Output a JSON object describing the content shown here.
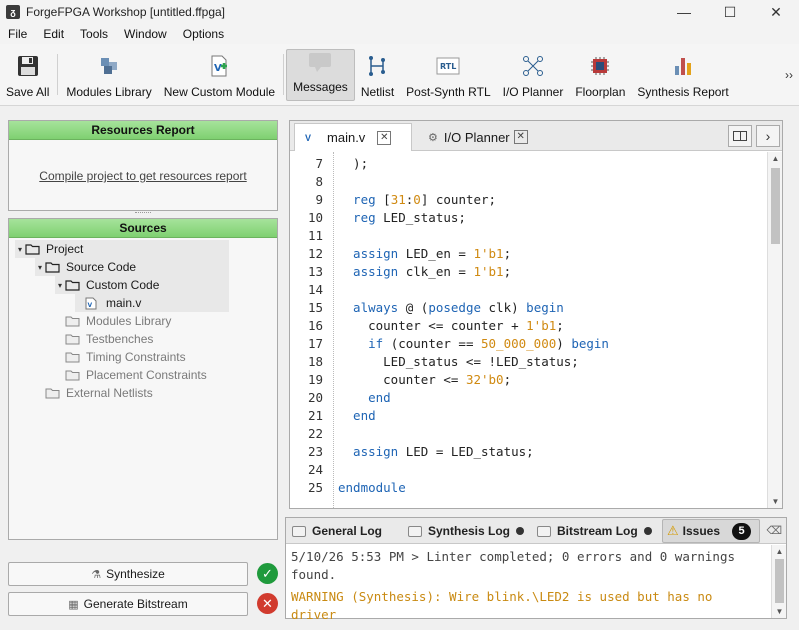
{
  "window": {
    "title": "ForgeFPGA Workshop [untitled.ffpga]",
    "app_icon": "ᵹ",
    "controls": [
      "—",
      "☐",
      "✕"
    ]
  },
  "menu": [
    "File",
    "Edit",
    "Tools",
    "Window",
    "Options"
  ],
  "toolbar": {
    "items": [
      {
        "label": "Save All",
        "icon": "floppy-icon"
      },
      {
        "label": "Modules Library",
        "icon": "cubes-icon"
      },
      {
        "label": "New Custom Module",
        "icon": "new-module-icon"
      },
      {
        "label": "Messages",
        "icon": "speech-bubble-icon",
        "active": true
      },
      {
        "label": "Netlist",
        "icon": "netlist-icon"
      },
      {
        "label": "Post-Synth RTL",
        "icon": "rtl-icon"
      },
      {
        "label": "I/O Planner",
        "icon": "io-planner-icon"
      },
      {
        "label": "Floorplan",
        "icon": "chip-icon"
      },
      {
        "label": "Synthesis Report",
        "icon": "bar-chart-icon"
      }
    ],
    "more": "››"
  },
  "resources": {
    "title": "Resources Report",
    "link": "Compile project to get resources report"
  },
  "sources": {
    "title": "Sources",
    "tree": [
      {
        "label": "Project",
        "level": 0,
        "caret": "▾",
        "type": "folder",
        "muted": false
      },
      {
        "label": "Source Code",
        "level": 1,
        "caret": "▾",
        "type": "folder",
        "muted": false
      },
      {
        "label": "Custom Code",
        "level": 2,
        "caret": "▾",
        "type": "folder",
        "muted": false
      },
      {
        "label": "main.v",
        "level": 3,
        "caret": "",
        "type": "file",
        "muted": false
      },
      {
        "label": "Modules Library",
        "level": 2,
        "caret": "",
        "type": "folder",
        "muted": true
      },
      {
        "label": "Testbenches",
        "level": 2,
        "caret": "",
        "type": "folder",
        "muted": true
      },
      {
        "label": "Timing Constraints",
        "level": 2,
        "caret": "",
        "type": "folder",
        "muted": true
      },
      {
        "label": "Placement Constraints",
        "level": 2,
        "caret": "",
        "type": "folder",
        "muted": true
      },
      {
        "label": "External Netlists",
        "level": 1,
        "caret": "",
        "type": "folder",
        "muted": true
      }
    ]
  },
  "actions": {
    "synthesize": "Synthesize",
    "synthesize_status": "✓",
    "generate": "Generate Bitstream",
    "generate_status": "✕"
  },
  "editor": {
    "tabs": [
      {
        "label": "main.v",
        "close": "✕"
      },
      {
        "label": "I/O Planner",
        "close": "✕"
      }
    ],
    "lines": [
      {
        "n": "7",
        "code": [
          [
            "t",
            "  );"
          ]
        ]
      },
      {
        "n": "8",
        "code": []
      },
      {
        "n": "9",
        "code": [
          [
            "k",
            "  reg "
          ],
          [
            "t",
            "["
          ],
          [
            "n",
            "31"
          ],
          [
            "t",
            ":"
          ],
          [
            "n",
            "0"
          ],
          [
            "t",
            "] counter;"
          ]
        ]
      },
      {
        "n": "10",
        "code": [
          [
            "k",
            "  reg "
          ],
          [
            "t",
            "LED_status;"
          ]
        ]
      },
      {
        "n": "11",
        "code": []
      },
      {
        "n": "12",
        "code": [
          [
            "k",
            "  assign "
          ],
          [
            "t",
            "LED_en = "
          ],
          [
            "n",
            "1'b1"
          ],
          [
            "t",
            ";"
          ]
        ]
      },
      {
        "n": "13",
        "code": [
          [
            "k",
            "  assign "
          ],
          [
            "t",
            "clk_en = "
          ],
          [
            "n",
            "1'b1"
          ],
          [
            "t",
            ";"
          ]
        ]
      },
      {
        "n": "14",
        "code": []
      },
      {
        "n": "15",
        "code": [
          [
            "k",
            "  always "
          ],
          [
            "t",
            "@ ("
          ],
          [
            "k",
            "posedge "
          ],
          [
            "t",
            "clk) "
          ],
          [
            "k",
            "begin"
          ]
        ]
      },
      {
        "n": "16",
        "code": [
          [
            "t",
            "    counter <= counter + "
          ],
          [
            "n",
            "1'b1"
          ],
          [
            "t",
            ";"
          ]
        ]
      },
      {
        "n": "17",
        "code": [
          [
            "k",
            "    if "
          ],
          [
            "t",
            "(counter == "
          ],
          [
            "n",
            "50_000_000"
          ],
          [
            "t",
            ") "
          ],
          [
            "k",
            "begin"
          ]
        ]
      },
      {
        "n": "18",
        "code": [
          [
            "t",
            "      LED_status <= !LED_status;"
          ]
        ]
      },
      {
        "n": "19",
        "code": [
          [
            "t",
            "      counter <= "
          ],
          [
            "n",
            "32'b0"
          ],
          [
            "t",
            ";"
          ]
        ]
      },
      {
        "n": "20",
        "code": [
          [
            "k",
            "    end"
          ]
        ]
      },
      {
        "n": "21",
        "code": [
          [
            "k",
            "  end"
          ]
        ]
      },
      {
        "n": "22",
        "code": []
      },
      {
        "n": "23",
        "code": [
          [
            "k",
            "  assign "
          ],
          [
            "t",
            "LED = LED_status;"
          ]
        ]
      },
      {
        "n": "24",
        "code": []
      },
      {
        "n": "25",
        "code": [
          [
            "k",
            "endmodule"
          ]
        ]
      }
    ]
  },
  "log": {
    "tabs": [
      {
        "label": "General Log",
        "dot": false
      },
      {
        "label": "Synthesis Log",
        "dot": true
      },
      {
        "label": "Bitstream Log",
        "dot": true
      },
      {
        "label": "Issues",
        "count": "5",
        "active": true
      }
    ],
    "lines": [
      "5/10/26 5:53 PM > Linter completed; 0 errors and 0 warnings",
      "found."
    ],
    "warning": "WARNING (Synthesis): Wire blink.\\LED2 is used but has no",
    "warning_cont": "driver"
  },
  "colors": {
    "panel_header": "#7fd071",
    "keyword": "#1e64b4",
    "number": "#d08a12",
    "ok": "#1f9a3c",
    "error": "#d13b2e",
    "warning": "#c98a12"
  }
}
